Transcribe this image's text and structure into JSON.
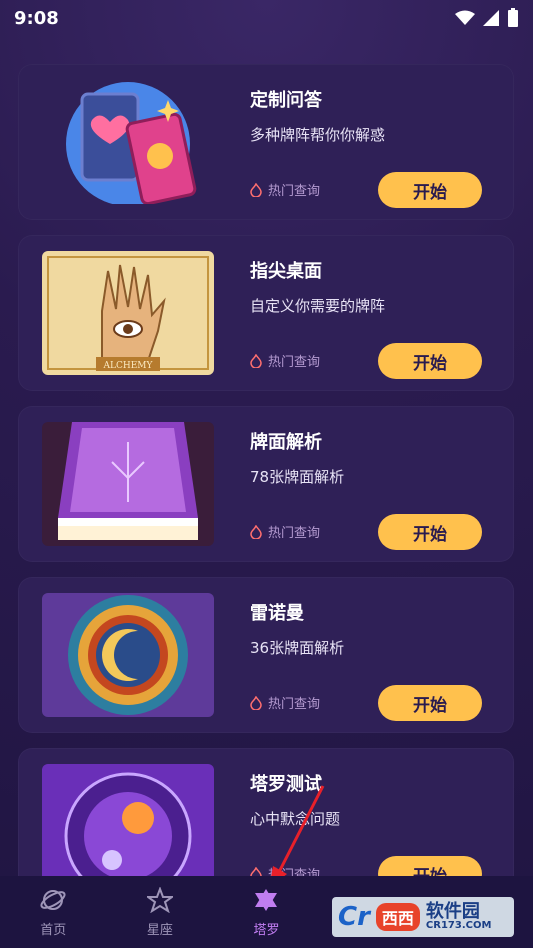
{
  "status": {
    "time": "9:08"
  },
  "cards": [
    {
      "title": "定制问答",
      "subtitle": "多种牌阵帮你你解惑",
      "hot": "热门查询",
      "button": "开始"
    },
    {
      "title": "指尖桌面",
      "subtitle": "自定义你需要的牌阵",
      "hot": "热门查询",
      "button": "开始"
    },
    {
      "title": "牌面解析",
      "subtitle": "78张牌面解析",
      "hot": "热门查询",
      "button": "开始"
    },
    {
      "title": "雷诺曼",
      "subtitle": "36张牌面解析",
      "hot": "热门查询",
      "button": "开始"
    },
    {
      "title": "塔罗测试",
      "subtitle": "心中默念问题",
      "hot": "热门查询",
      "button": "开始"
    }
  ],
  "thumb2": {
    "caption": "ALCHEMY"
  },
  "tabs": [
    {
      "label": "首页",
      "icon": "planet-icon"
    },
    {
      "label": "星座",
      "icon": "star-icon"
    },
    {
      "label": "塔罗",
      "icon": "hexagram-icon",
      "active": true
    },
    {
      "label": "",
      "icon": "heart-icon"
    },
    {
      "label": "",
      "icon": "person-icon"
    }
  ],
  "watermark": {
    "brand": "西西",
    "text": "软件园",
    "domain": "CR173.COM",
    "letter": "Cr"
  },
  "colors": {
    "accent": "#ffc14d",
    "active_tab": "#c07df0",
    "card": "#2f2057"
  }
}
